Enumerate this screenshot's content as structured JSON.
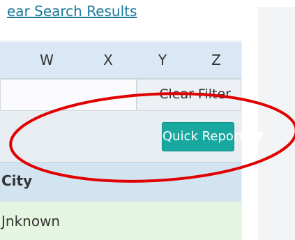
{
  "links": {
    "clear_search_results": "ear Search Results"
  },
  "alphabet": {
    "letters": [
      "W",
      "X",
      "Y",
      "Z"
    ]
  },
  "filter": {
    "clear_label": "Clear Filter",
    "value": ""
  },
  "toolbar": {
    "quick_reports_label": "Quick Reports ▼"
  },
  "table": {
    "columns": [
      "City"
    ],
    "column_header_visible": "City",
    "rows": [
      {
        "city": "Jnknown"
      }
    ]
  },
  "colors": {
    "accent_button": "#17a8a0",
    "link": "#1a7a9c",
    "header_row": "#d3e4f1",
    "data_row": "#e4f5e0",
    "annotation_circle": "#e00000"
  }
}
